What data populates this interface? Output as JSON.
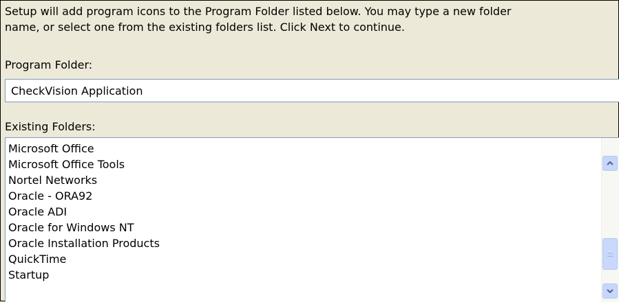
{
  "dialog": {
    "intro_text": "Setup will add program icons to the Program Folder listed below.  You may type a new folder\nname, or select one from the existing folders list.  Click Next to continue.",
    "program_folder_label": "Program Folder:",
    "program_folder_value": "CheckVision Application",
    "existing_folders_label": "Existing Folders:"
  },
  "existing_folders": [
    "Microsoft Office",
    "Microsoft Office Tools",
    "Nortel Networks",
    "Oracle - ORA92",
    "Oracle ADI",
    "Oracle for Windows NT",
    "Oracle Installation Products",
    "QuickTime",
    "Startup"
  ],
  "scrollbar": {
    "up_icon": "chevron-up-icon",
    "down_icon": "chevron-down-icon",
    "accent_color": "#4d6185"
  }
}
